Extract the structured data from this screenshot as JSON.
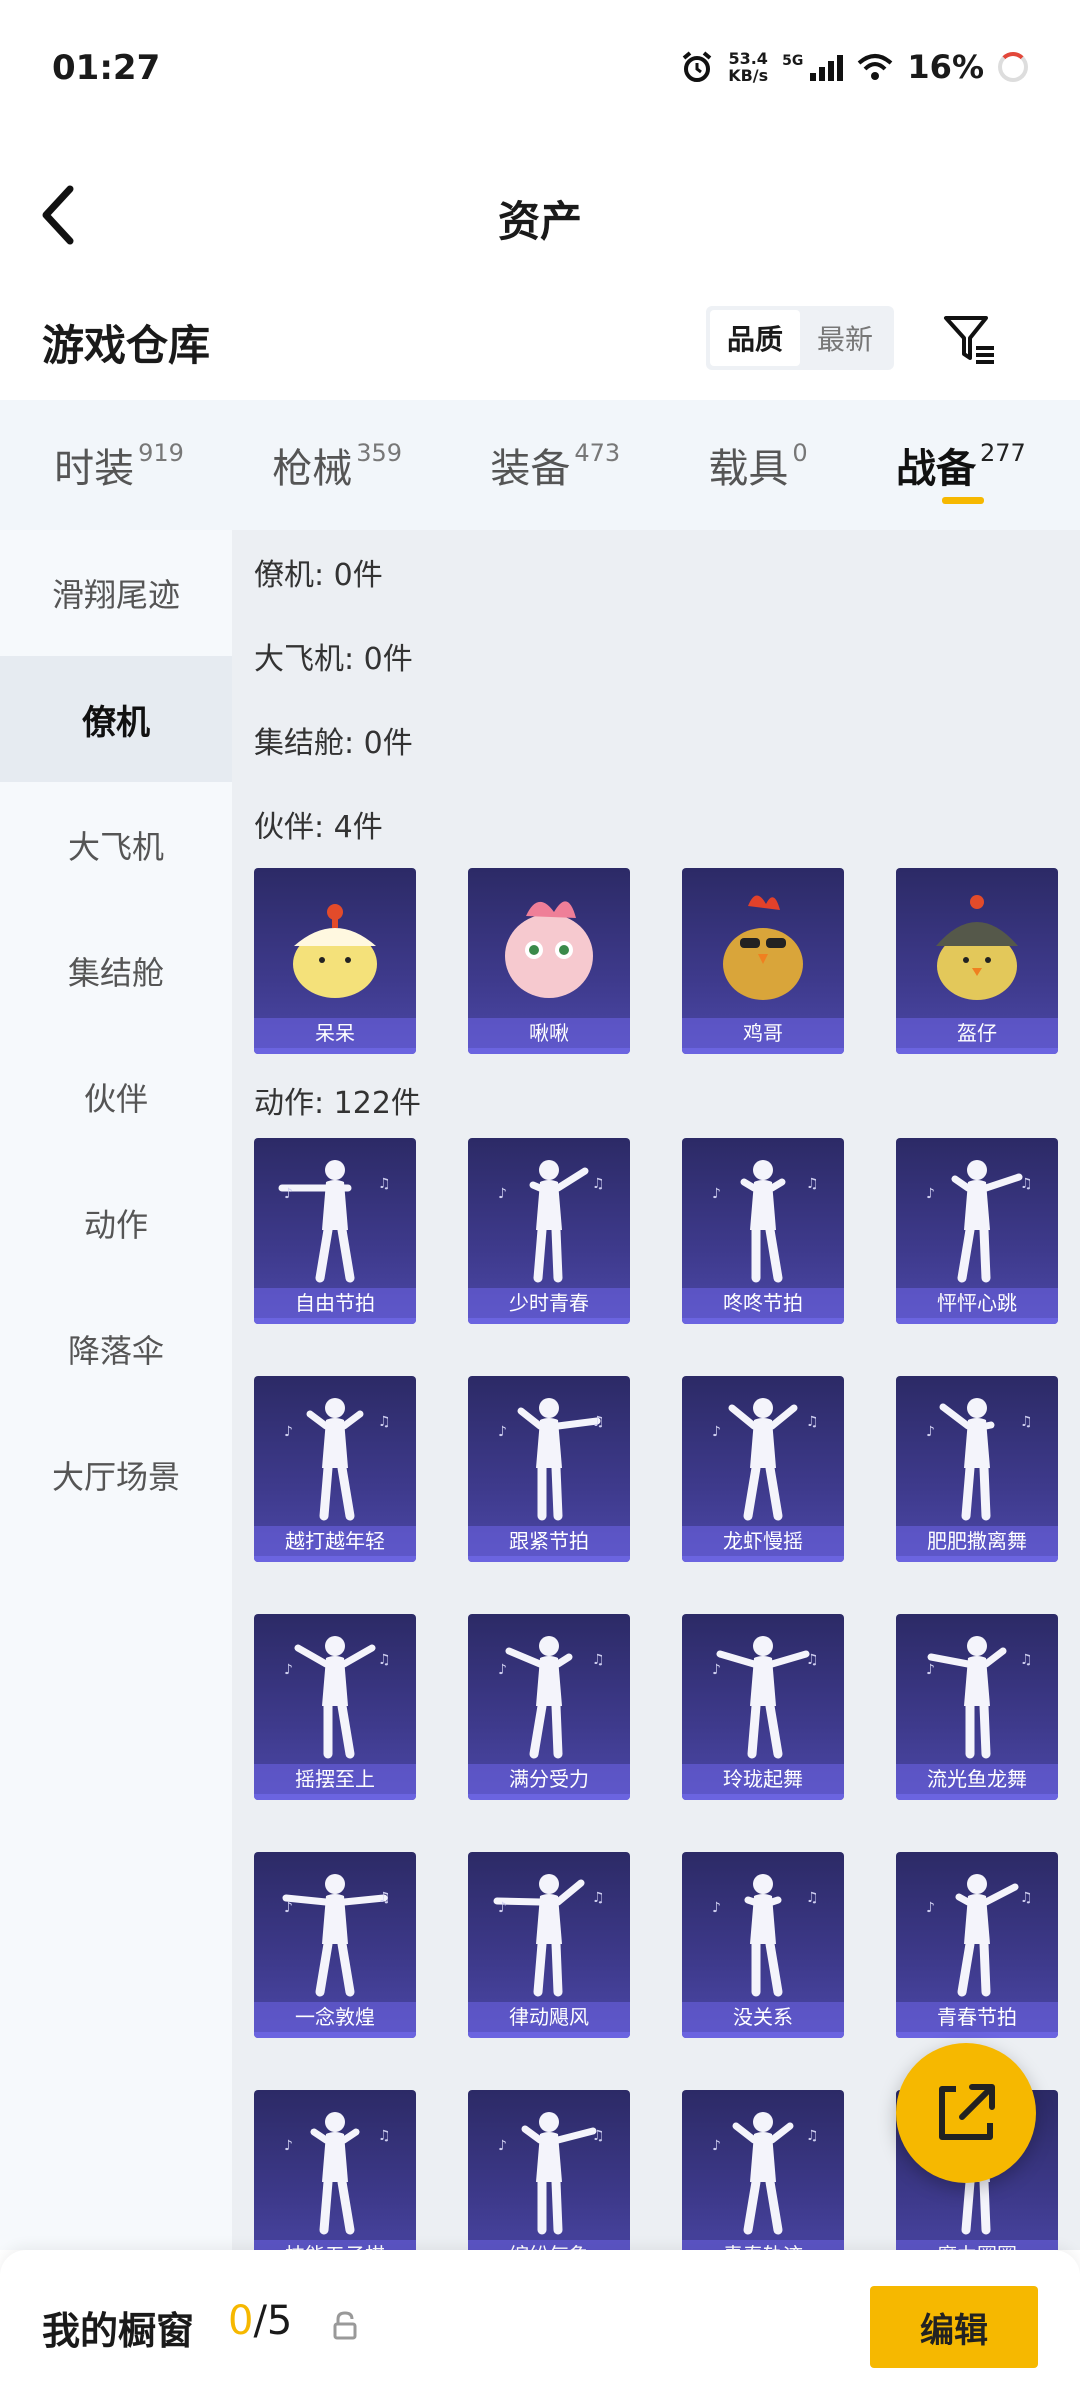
{
  "status": {
    "time": "01:27",
    "net_speed_value": "53.4",
    "net_speed_unit": "KB/s",
    "network_gen": "5G",
    "battery": "16%"
  },
  "header": {
    "title": "资产"
  },
  "section": {
    "title": "游戏仓库",
    "sort_quality": "品质",
    "sort_newest": "最新"
  },
  "main_tabs": [
    {
      "label": "时装",
      "count": "919"
    },
    {
      "label": "枪械",
      "count": "359"
    },
    {
      "label": "装备",
      "count": "473"
    },
    {
      "label": "载具",
      "count": "0"
    },
    {
      "label": "战备",
      "count": "277"
    }
  ],
  "sidebar": {
    "items": [
      {
        "label": "滑翔尾迹"
      },
      {
        "label": "僚机"
      },
      {
        "label": "大飞机"
      },
      {
        "label": "集结舱"
      },
      {
        "label": "伙伴"
      },
      {
        "label": "动作"
      },
      {
        "label": "降落伞"
      },
      {
        "label": "大厅场景"
      }
    ]
  },
  "content": {
    "categories": [
      {
        "label": "僚机: 0件"
      },
      {
        "label": "大飞机: 0件"
      },
      {
        "label": "集结舱: 0件"
      },
      {
        "label": "伙伴: 4件"
      },
      {
        "label": "动作: 122件"
      }
    ],
    "partners": [
      {
        "name": "呆呆"
      },
      {
        "name": "啾啾"
      },
      {
        "name": "鸡哥"
      },
      {
        "name": "盔仔"
      }
    ],
    "emotes": [
      {
        "name": "自由节拍"
      },
      {
        "name": "少时青春"
      },
      {
        "name": "咚咚节拍"
      },
      {
        "name": "怦怦心跳"
      },
      {
        "name": "越打越年轻"
      },
      {
        "name": "跟紧节拍"
      },
      {
        "name": "龙虾慢摇"
      },
      {
        "name": "肥肥撒离舞"
      },
      {
        "name": "摇摆至上"
      },
      {
        "name": "满分受力"
      },
      {
        "name": "玲珑起舞"
      },
      {
        "name": "流光鱼龙舞"
      },
      {
        "name": "一念敦煌"
      },
      {
        "name": "律动飓风"
      },
      {
        "name": "没关系"
      },
      {
        "name": "青春节拍"
      },
      {
        "name": "技能五子棋"
      },
      {
        "name": "缤纷气象"
      },
      {
        "name": "青春轨迹"
      },
      {
        "name": "魔力圈圈"
      }
    ]
  },
  "bottom": {
    "shelf_label": "我的橱窗",
    "shelf_current": "0",
    "shelf_total": "/5",
    "edit_label": "编辑"
  },
  "colors": {
    "accent": "#f6b800",
    "card_bg": "#3e3a8c"
  }
}
